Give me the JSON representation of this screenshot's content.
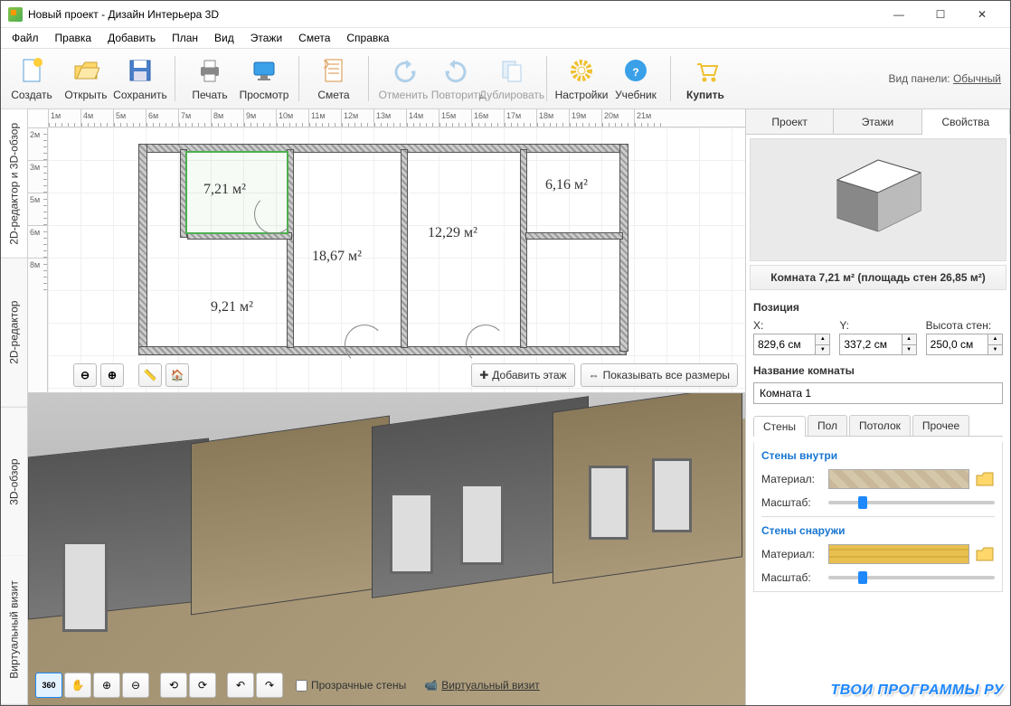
{
  "window": {
    "title": "Новый проект - Дизайн Интерьера 3D"
  },
  "menu": [
    "Файл",
    "Правка",
    "Добавить",
    "План",
    "Вид",
    "Этажи",
    "Смета",
    "Справка"
  ],
  "toolbar": {
    "groups": [
      [
        "Создать",
        "Открыть",
        "Сохранить"
      ],
      [
        "Печать",
        "Просмотр"
      ],
      [
        "Смета"
      ],
      [
        "Отменить",
        "Повторить",
        "Дублировать"
      ],
      [
        "Настройки",
        "Учебник"
      ],
      [
        "Купить"
      ]
    ],
    "panel_label": "Вид панели:",
    "panel_mode": "Обычный"
  },
  "vtabs": [
    "2D-редактор и 3D-обзор",
    "2D-редактор",
    "3D-обзор",
    "Виртуальный визит"
  ],
  "ruler_h": [
    "1м",
    "4м",
    "5м",
    "6м",
    "7м",
    "8м",
    "9м",
    "10м",
    "11м",
    "12м",
    "13м",
    "14м",
    "15м",
    "16м",
    "17м",
    "18м",
    "19м",
    "20м",
    "21м"
  ],
  "ruler_v": [
    "2м",
    "3м",
    "5м",
    "6м",
    "8м"
  ],
  "room_areas": {
    "r1": "7,21 м²",
    "r2": "6,16 м²",
    "r3": "18,67 м²",
    "r4": "12,29 м²",
    "r5": "9,21 м²"
  },
  "plan_buttons": {
    "add_floor": "Добавить этаж",
    "show_dims": "Показывать все размеры"
  },
  "view3d": {
    "transparent": "Прозрачные стены",
    "virtual": "Виртуальный визит"
  },
  "right": {
    "tabs": [
      "Проект",
      "Этажи",
      "Свойства"
    ],
    "info": "Комната 7,21 м²  (площадь стен 26,85 м²)",
    "pos_title": "Позиция",
    "x_label": "X:",
    "y_label": "Y:",
    "h_label": "Высота стен:",
    "x": "829,6 см",
    "y": "337,2 см",
    "h": "250,0 см",
    "name_title": "Название комнаты",
    "name": "Комната 1",
    "subtabs": [
      "Стены",
      "Пол",
      "Потолок",
      "Прочее"
    ],
    "walls_in": "Стены внутри",
    "walls_out": "Стены снаружи",
    "material": "Материал:",
    "scale": "Масштаб:"
  },
  "watermark": "ТВОИ ПРОГРАММЫ РУ"
}
